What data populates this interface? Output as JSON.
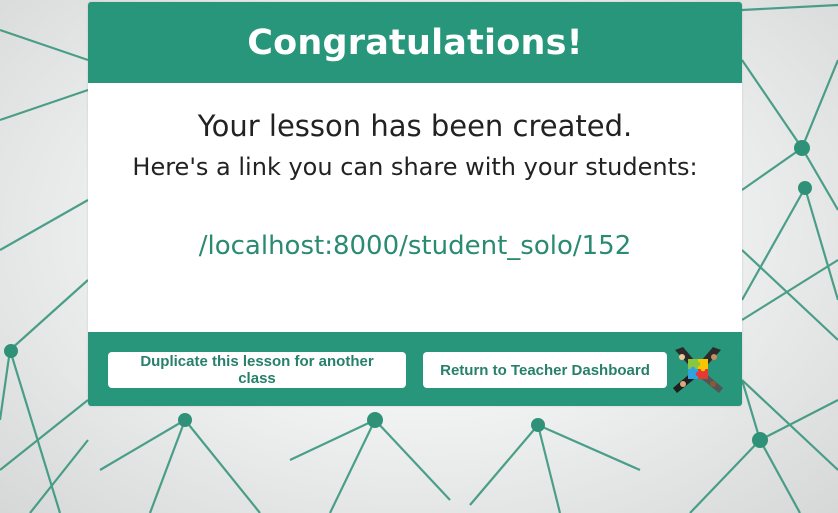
{
  "dialog": {
    "title": "Congratulations!",
    "message": "Your lesson has been created.",
    "share_prompt": "Here's a link you can share with your students:",
    "share_link": "/localhost:8000/student_solo/152"
  },
  "footer": {
    "duplicate_label": "Duplicate this lesson for another class",
    "return_label": "Return to Teacher Dashboard",
    "logo_icon": "puzzle-hands-logo-icon"
  },
  "colors": {
    "accent": "#28967a",
    "link": "#2a8a72",
    "button_text": "#26806a"
  }
}
